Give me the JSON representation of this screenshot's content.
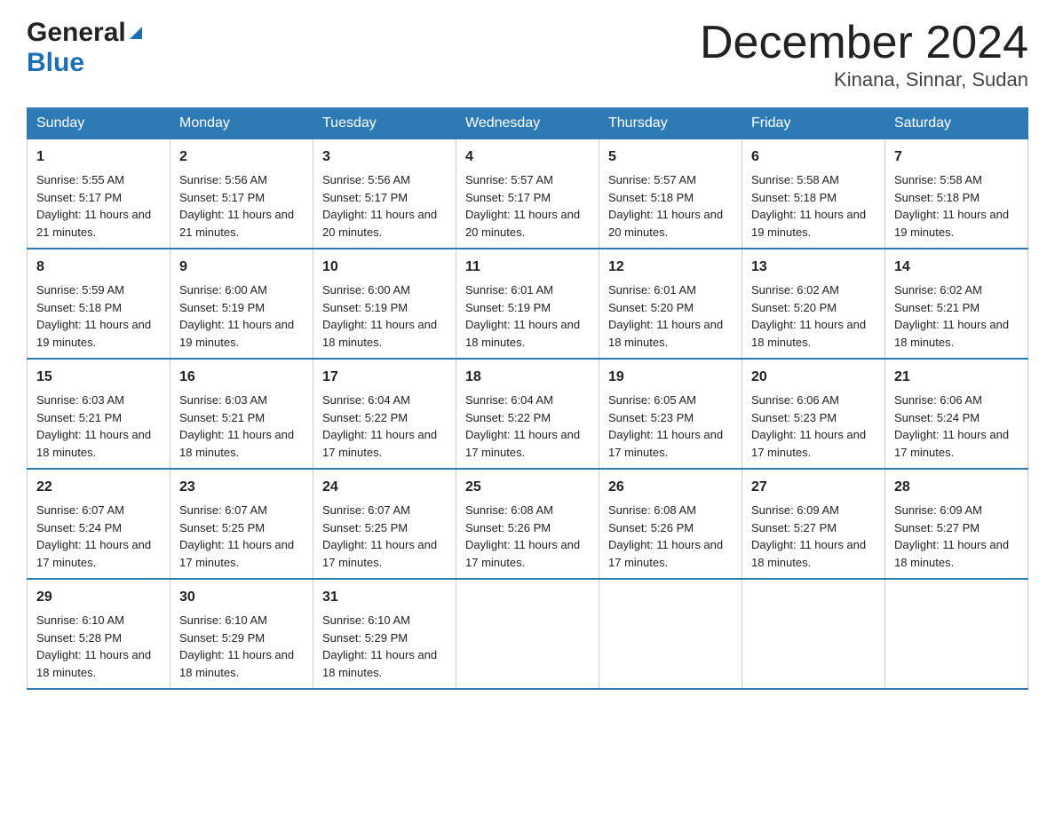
{
  "header": {
    "logo_general": "General",
    "logo_blue": "Blue",
    "title": "December 2024",
    "subtitle": "Kinana, Sinnar, Sudan"
  },
  "days": [
    "Sunday",
    "Monday",
    "Tuesday",
    "Wednesday",
    "Thursday",
    "Friday",
    "Saturday"
  ],
  "weeks": [
    [
      {
        "num": "1",
        "sunrise": "5:55 AM",
        "sunset": "5:17 PM",
        "daylight": "11 hours and 21 minutes."
      },
      {
        "num": "2",
        "sunrise": "5:56 AM",
        "sunset": "5:17 PM",
        "daylight": "11 hours and 21 minutes."
      },
      {
        "num": "3",
        "sunrise": "5:56 AM",
        "sunset": "5:17 PM",
        "daylight": "11 hours and 20 minutes."
      },
      {
        "num": "4",
        "sunrise": "5:57 AM",
        "sunset": "5:17 PM",
        "daylight": "11 hours and 20 minutes."
      },
      {
        "num": "5",
        "sunrise": "5:57 AM",
        "sunset": "5:18 PM",
        "daylight": "11 hours and 20 minutes."
      },
      {
        "num": "6",
        "sunrise": "5:58 AM",
        "sunset": "5:18 PM",
        "daylight": "11 hours and 19 minutes."
      },
      {
        "num": "7",
        "sunrise": "5:58 AM",
        "sunset": "5:18 PM",
        "daylight": "11 hours and 19 minutes."
      }
    ],
    [
      {
        "num": "8",
        "sunrise": "5:59 AM",
        "sunset": "5:18 PM",
        "daylight": "11 hours and 19 minutes."
      },
      {
        "num": "9",
        "sunrise": "6:00 AM",
        "sunset": "5:19 PM",
        "daylight": "11 hours and 19 minutes."
      },
      {
        "num": "10",
        "sunrise": "6:00 AM",
        "sunset": "5:19 PM",
        "daylight": "11 hours and 18 minutes."
      },
      {
        "num": "11",
        "sunrise": "6:01 AM",
        "sunset": "5:19 PM",
        "daylight": "11 hours and 18 minutes."
      },
      {
        "num": "12",
        "sunrise": "6:01 AM",
        "sunset": "5:20 PM",
        "daylight": "11 hours and 18 minutes."
      },
      {
        "num": "13",
        "sunrise": "6:02 AM",
        "sunset": "5:20 PM",
        "daylight": "11 hours and 18 minutes."
      },
      {
        "num": "14",
        "sunrise": "6:02 AM",
        "sunset": "5:21 PM",
        "daylight": "11 hours and 18 minutes."
      }
    ],
    [
      {
        "num": "15",
        "sunrise": "6:03 AM",
        "sunset": "5:21 PM",
        "daylight": "11 hours and 18 minutes."
      },
      {
        "num": "16",
        "sunrise": "6:03 AM",
        "sunset": "5:21 PM",
        "daylight": "11 hours and 18 minutes."
      },
      {
        "num": "17",
        "sunrise": "6:04 AM",
        "sunset": "5:22 PM",
        "daylight": "11 hours and 17 minutes."
      },
      {
        "num": "18",
        "sunrise": "6:04 AM",
        "sunset": "5:22 PM",
        "daylight": "11 hours and 17 minutes."
      },
      {
        "num": "19",
        "sunrise": "6:05 AM",
        "sunset": "5:23 PM",
        "daylight": "11 hours and 17 minutes."
      },
      {
        "num": "20",
        "sunrise": "6:06 AM",
        "sunset": "5:23 PM",
        "daylight": "11 hours and 17 minutes."
      },
      {
        "num": "21",
        "sunrise": "6:06 AM",
        "sunset": "5:24 PM",
        "daylight": "11 hours and 17 minutes."
      }
    ],
    [
      {
        "num": "22",
        "sunrise": "6:07 AM",
        "sunset": "5:24 PM",
        "daylight": "11 hours and 17 minutes."
      },
      {
        "num": "23",
        "sunrise": "6:07 AM",
        "sunset": "5:25 PM",
        "daylight": "11 hours and 17 minutes."
      },
      {
        "num": "24",
        "sunrise": "6:07 AM",
        "sunset": "5:25 PM",
        "daylight": "11 hours and 17 minutes."
      },
      {
        "num": "25",
        "sunrise": "6:08 AM",
        "sunset": "5:26 PM",
        "daylight": "11 hours and 17 minutes."
      },
      {
        "num": "26",
        "sunrise": "6:08 AM",
        "sunset": "5:26 PM",
        "daylight": "11 hours and 17 minutes."
      },
      {
        "num": "27",
        "sunrise": "6:09 AM",
        "sunset": "5:27 PM",
        "daylight": "11 hours and 18 minutes."
      },
      {
        "num": "28",
        "sunrise": "6:09 AM",
        "sunset": "5:27 PM",
        "daylight": "11 hours and 18 minutes."
      }
    ],
    [
      {
        "num": "29",
        "sunrise": "6:10 AM",
        "sunset": "5:28 PM",
        "daylight": "11 hours and 18 minutes."
      },
      {
        "num": "30",
        "sunrise": "6:10 AM",
        "sunset": "5:29 PM",
        "daylight": "11 hours and 18 minutes."
      },
      {
        "num": "31",
        "sunrise": "6:10 AM",
        "sunset": "5:29 PM",
        "daylight": "11 hours and 18 minutes."
      },
      null,
      null,
      null,
      null
    ]
  ],
  "labels": {
    "sunrise": "Sunrise:",
    "sunset": "Sunset:",
    "daylight": "Daylight:"
  }
}
